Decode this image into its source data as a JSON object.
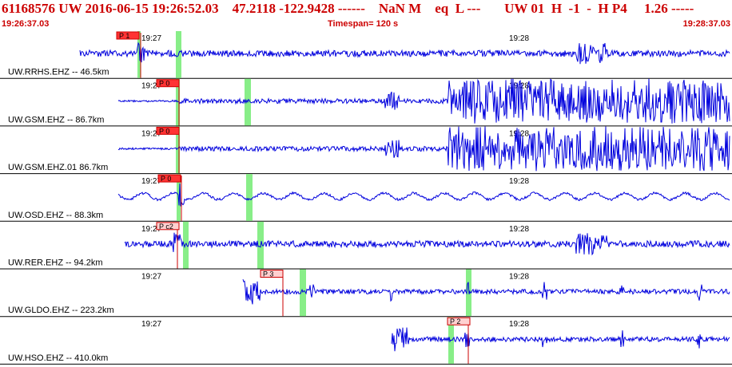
{
  "header": {
    "title": "61168576 UW 2016-06-15 19:26:52.03    47.2118 -122.9428 ------    NaN M    eq  L ---       UW 01  H  -1  -  H P4     1.26 -----",
    "start_time": "19:26:37.03",
    "timespan": "Timespan= 120 s",
    "end_time": "19:28:37.03"
  },
  "colors": {
    "header_text": "#cc0000",
    "trace": "#0000dd",
    "pick_line": "#cc0000",
    "pick_flag_fill": "#ff3333",
    "pick_flag_light": "#ffd0d0",
    "window_marker": "#88ee88",
    "separator": "#000000"
  },
  "time_labels": [
    "19:27",
    "19:28"
  ],
  "traces": [
    {
      "label": "UW.RRHS.EHZ -- 46.5km",
      "pick": "P 1",
      "amplitude": "low",
      "onset": "P 1 onset"
    },
    {
      "label": "UW.GSM.EHZ -- 86.7km",
      "pick": "P 0",
      "amplitude": "clipped",
      "onset": "P 0 onset"
    },
    {
      "label": "UW.GSM.EHZ.01 86.7km",
      "pick": "P 0",
      "amplitude": "clipped",
      "onset": "P 0 onset"
    },
    {
      "label": "UW.OSD.EHZ -- 88.3km",
      "pick": "P 0",
      "amplitude": "wavy",
      "onset": "P 0 onset"
    },
    {
      "label": "UW.RER.EHZ -- 94.2km",
      "pick": "P c2",
      "amplitude": "low",
      "onset": "P c2 onset"
    },
    {
      "label": "UW.GLDO.EHZ -- 223.2km",
      "pick": "P 3",
      "amplitude": "medium",
      "onset": "P 3 onset"
    },
    {
      "label": "UW.HSO.EHZ -- 410.0km",
      "pick": "P 2",
      "amplitude": "medium",
      "onset": "P 2 onset"
    }
  ]
}
